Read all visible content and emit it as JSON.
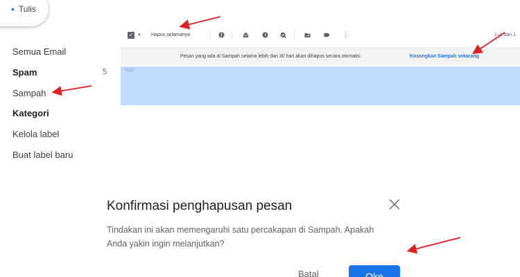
{
  "compose": {
    "icon": "plus-icon",
    "label": "Tulis"
  },
  "sidebar": {
    "items": [
      {
        "label": "Semua Email",
        "bold": false,
        "count": ""
      },
      {
        "label": "Spam",
        "bold": true,
        "count": "5"
      },
      {
        "label": "Sampah",
        "bold": false,
        "count": ""
      },
      {
        "label": "Kategori",
        "bold": true,
        "count": ""
      },
      {
        "label": "Kelola label",
        "bold": false,
        "count": ""
      },
      {
        "label": "Buat label baru",
        "bold": false,
        "count": ""
      }
    ]
  },
  "toolbar": {
    "delete_forever": "Hapus selamanya",
    "icons": [
      "select-checkbox-icon",
      "report-spam-icon",
      "mark-unread-icon",
      "snooze-icon",
      "add-to-tasks-icon",
      "move-to-icon",
      "label-icon",
      "more-icon"
    ],
    "page_count": "1–1 dari 1"
  },
  "banner": {
    "message": "Pesan yang ada di Sampah selama lebih dari 30 hari akan dihapus secara otomatis.",
    "link": "Kosongkan Sampah sekarang"
  },
  "dialog": {
    "title": "Konfirmasi penghapusan pesan",
    "body_line1": "Tindakan ini akan memengaruhi satu percakapan di Sampah. Apakah",
    "body_line2": "Anda yakin ingin melanjutkan?",
    "cancel": "Batal",
    "ok": "Oke"
  },
  "colors": {
    "accent": "#1a73e8",
    "selected_row": "#c2dbff",
    "banner_bg": "#f1f3f4",
    "annotation_arrow": "#e02020"
  }
}
